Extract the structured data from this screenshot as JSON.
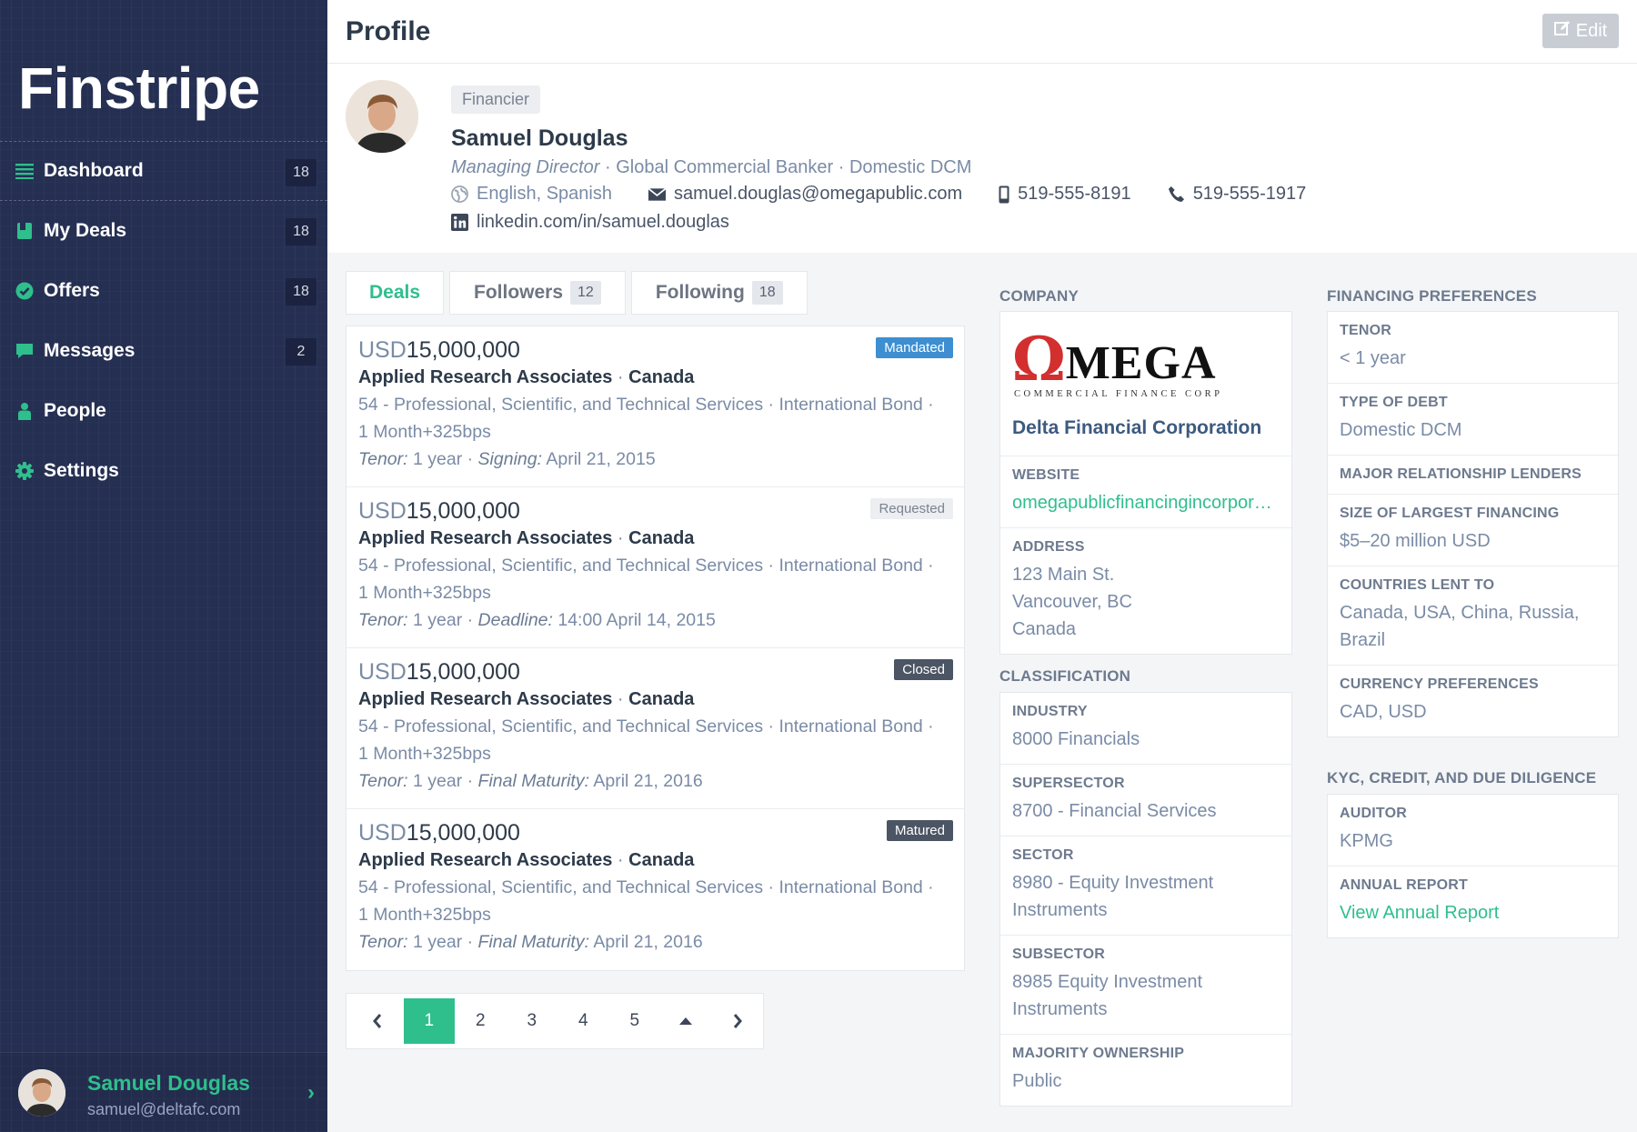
{
  "app": {
    "brand": "Finstripe",
    "page_title": "Profile",
    "edit_label": "Edit"
  },
  "sidebar": {
    "items": [
      {
        "label": "Dashboard",
        "count": "18",
        "icon": "list-icon"
      },
      {
        "label": "My Deals",
        "count": "18",
        "icon": "book-icon"
      },
      {
        "label": "Offers",
        "count": "18",
        "icon": "check-circle-icon"
      },
      {
        "label": "Messages",
        "count": "2",
        "icon": "chat-icon"
      },
      {
        "label": "People",
        "count": "",
        "icon": "person-icon"
      },
      {
        "label": "Settings",
        "count": "",
        "icon": "gear-icon"
      }
    ],
    "user": {
      "name": "Samuel Douglas",
      "email": "samuel@deltafc.com"
    }
  },
  "profile": {
    "role": "Financier",
    "name": "Samuel Douglas",
    "title": "Managing Director",
    "title_rest": " · Global Commercial Banker · Domestic DCM",
    "languages": "English, Spanish",
    "email": "samuel.douglas@omegapublic.com",
    "mobile": "519-555-8191",
    "phone": "519-555-1917",
    "linkedin": "linkedin.com/in/samuel.douglas"
  },
  "tabs": [
    {
      "label": "Deals",
      "count": ""
    },
    {
      "label": "Followers",
      "count": "12"
    },
    {
      "label": "Following",
      "count": "18"
    }
  ],
  "deals": [
    {
      "currency": "USD",
      "amount": "15,000,000",
      "company": "Applied Research Associates",
      "country": "Canada",
      "industry": "54 - Professional, Scientific, and Technical Services",
      "product": "International Bond",
      "rate": "1 Month+325bps",
      "tenor_label": "Tenor:",
      "tenor": "1 year",
      "date_label": "Signing:",
      "date": "April 21, 2015",
      "status": "Mandated"
    },
    {
      "currency": "USD",
      "amount": "15,000,000",
      "company": "Applied Research Associates",
      "country": "Canada",
      "industry": "54 - Professional, Scientific, and Technical Services",
      "product": "International Bond",
      "rate": "1 Month+325bps",
      "tenor_label": "Tenor:",
      "tenor": "1 year",
      "date_label": "Deadline:",
      "date": "14:00 April 14, 2015",
      "status": "Requested"
    },
    {
      "currency": "USD",
      "amount": "15,000,000",
      "company": "Applied Research Associates",
      "country": "Canada",
      "industry": "54 - Professional, Scientific, and Technical Services",
      "product": "International Bond",
      "rate": "1 Month+325bps",
      "tenor_label": "Tenor:",
      "tenor": "1 year",
      "date_label": "Final Maturity:",
      "date": "April 21, 2016",
      "status": "Closed"
    },
    {
      "currency": "USD",
      "amount": "15,000,000",
      "company": "Applied Research Associates",
      "country": "Canada",
      "industry": "54 - Professional, Scientific, and Technical Services",
      "product": "International Bond",
      "rate": "1 Month+325bps",
      "tenor_label": "Tenor:",
      "tenor": "1 year",
      "date_label": "Final Maturity:",
      "date": "April 21, 2016",
      "status": "Matured"
    }
  ],
  "pagination": {
    "pages": [
      "1",
      "2",
      "3",
      "4",
      "5"
    ],
    "current": "1"
  },
  "company": {
    "section_title": "COMPANY",
    "logo_main": "MEGA",
    "logo_omega": "Ω",
    "logo_sub": "COMMERCIAL FINANCE CORP",
    "name": "Delta Financial Corporation",
    "website_label": "WEBSITE",
    "website": "omegapublicfinancingincorporated.com",
    "address_label": "ADDRESS",
    "address": [
      "123 Main St.",
      "Vancouver, BC",
      "Canada"
    ]
  },
  "classification": {
    "section_title": "CLASSIFICATION",
    "fields": [
      {
        "label": "INDUSTRY",
        "value": "8000 Financials"
      },
      {
        "label": "SUPERSECTOR",
        "value": "8700 - Financial Services"
      },
      {
        "label": "SECTOR",
        "value": "8980 - Equity Investment Instruments"
      },
      {
        "label": "SUBSECTOR",
        "value": "8985 Equity Investment Instruments"
      },
      {
        "label": "MAJORITY OWNERSHIP",
        "value": "Public"
      }
    ]
  },
  "financing": {
    "section_title": "FINANCING PREFERENCES",
    "fields": [
      {
        "label": "TENOR",
        "value": "< 1 year"
      },
      {
        "label": "TYPE OF DEBT",
        "value": "Domestic DCM"
      },
      {
        "label": "MAJOR RELATIONSHIP LENDERS",
        "value": ""
      },
      {
        "label": "SIZE OF LARGEST FINANCING",
        "value": "$5–20 million USD"
      },
      {
        "label": "COUNTRIES LENT TO",
        "value": "Canada, USA, China, Russia, Brazil"
      },
      {
        "label": "CURRENCY PREFERENCES",
        "value": "CAD, USD"
      }
    ]
  },
  "kyc": {
    "section_title": "KYC, CREDIT, AND DUE DILIGENCE",
    "fields": [
      {
        "label": "AUDITOR",
        "value": "KPMG"
      },
      {
        "label": "ANNUAL REPORT",
        "value": "View Annual Report"
      }
    ]
  },
  "colors": {
    "accent": "#2ebf8d",
    "sidebar": "#252f52",
    "mandated": "#3d8fd1",
    "closed": "#4b5563"
  }
}
